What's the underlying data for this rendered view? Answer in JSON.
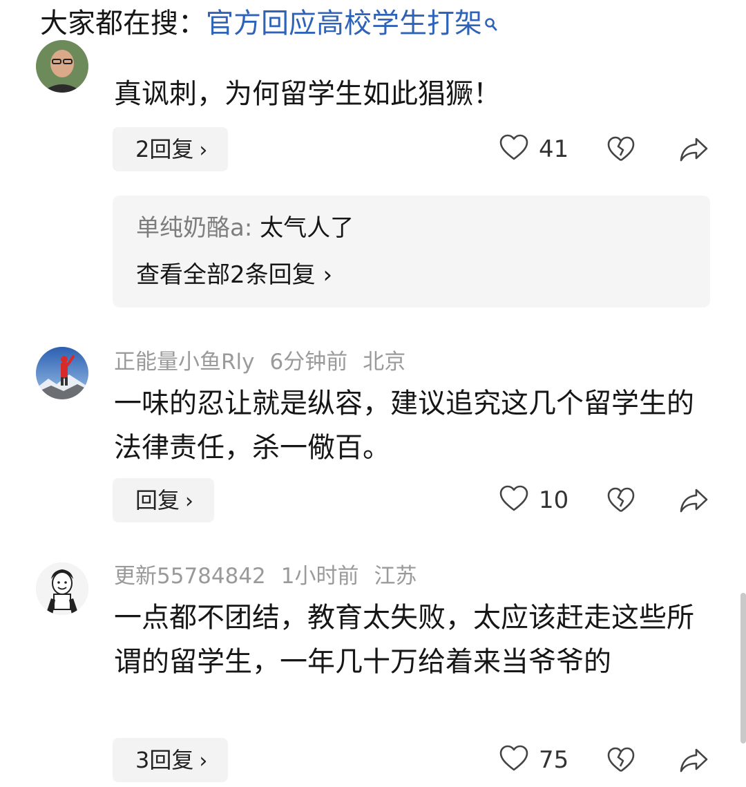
{
  "search": {
    "prefix": "大家都在搜：",
    "query": "官方回应高校学生打架"
  },
  "comments": [
    {
      "text": "真讽刺，为何留学生如此猖獗！",
      "reply_label": "2回复",
      "likes": "41",
      "preview": {
        "user": "单纯奶酪a:",
        "text": " 太气人了",
        "view_all": "查看全部2条回复"
      }
    },
    {
      "user": "正能量小鱼Rly",
      "time": "6分钟前",
      "location": "北京",
      "text": "一味的忍让就是纵容，建议追究这几个留学生的法律责任，杀一儆百。",
      "reply_label": "回复",
      "likes": "10"
    },
    {
      "user": "更新55784842",
      "time": "1小时前",
      "location": "江苏",
      "text": "一点都不团结，教育太失败，太应该赶走这些所谓的留学生，一年几十万给着来当爷爷的",
      "reply_label": "3回复",
      "likes": "75"
    }
  ],
  "icons": {
    "search": "search-icon",
    "like": "heart-outline-icon",
    "dislike": "broken-heart-icon",
    "share": "share-arrow-icon",
    "chevron": "chevron-right-icon"
  },
  "colors": {
    "link": "#2f63b8",
    "meta": "#9a9a9a",
    "text": "#161616",
    "button_bg": "#f3f3f3"
  }
}
